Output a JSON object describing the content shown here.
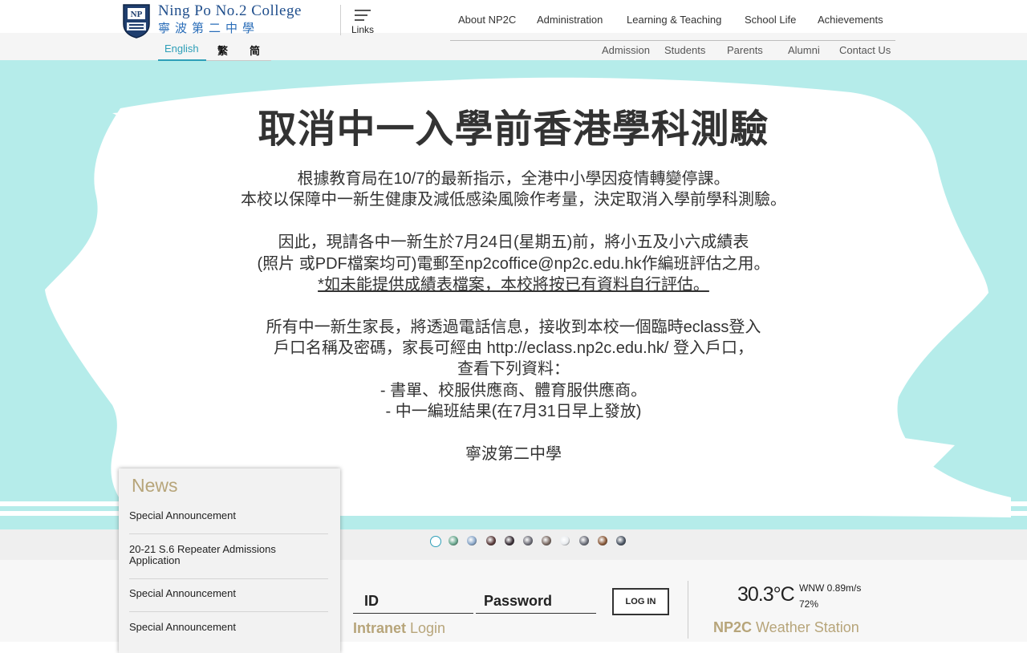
{
  "brand": {
    "name_en": "Ning Po No.2 College",
    "name_zh": "寧波第二中學"
  },
  "languages": [
    "English",
    "繁",
    "简"
  ],
  "links_label": "Links",
  "nav": {
    "main": [
      "About NP2C",
      "Administration",
      "Learning & Teaching",
      "School Life",
      "Achievements"
    ],
    "sub": [
      "Admission",
      "Students",
      "Parents",
      "Alumni",
      "Contact Us"
    ]
  },
  "announcement": {
    "title": "取消中一入學前香港學科測驗",
    "lines": [
      "根據教育局在10/7的最新指示，全港中小學因疫情轉變停課。",
      "本校以保障中一新生健康及減低感染風險作考量，決定取消入學前學科測驗。",
      "因此，現請各中一新生於7月24日(星期五)前，將小五及小六成績表",
      "(照片 或PDF檔案均可)電郵至np2coffice@np2c.edu.hk作編班評估之用。",
      "*如未能提供成績表檔案，本校將按已有資料自行評估。",
      "所有中一新生家長，將透過電話信息，接收到本校一個臨時eclass登入",
      "戶口名稱及密碼，家長可經由 http://eclass.np2c.edu.hk/ 登入戶口，",
      "查看下列資料：",
      "- 書單、校服供應商、體育服供應商。",
      "- 中一編班結果(在7月31日早上發放)",
      "寧波第二中學"
    ]
  },
  "carousel": {
    "active_index": 0,
    "thumb_colors": [
      "#ffffff",
      "#6aa88f",
      "#8aa7c9",
      "#5a3b3b",
      "#3a2f37",
      "#6e6e78",
      "#7a6a63",
      "#e9ecef",
      "#6c6f7a",
      "#8a5a3a",
      "#4b5563"
    ]
  },
  "news": {
    "title": "News",
    "items": [
      "Special Announcement",
      "20-21 S.6 Repeater Admissions Application",
      "Special Announcement",
      "Special Announcement"
    ]
  },
  "login": {
    "id_placeholder": "ID",
    "password_placeholder": "Password",
    "button": "LOG IN",
    "intranet_strong": "Intranet",
    "intranet_rest": " Login"
  },
  "weather": {
    "temperature": "30.3°C",
    "wind": "WNW 0.89m/s",
    "humidity": "72%",
    "station_strong": "NP2C",
    "station_rest": " Weather Station"
  },
  "colors": {
    "brand_blue": "#1f4e8c",
    "accent_teal": "#2e9fb8",
    "banner_bg": "#b5ecea",
    "gold": "#b7a57a"
  }
}
